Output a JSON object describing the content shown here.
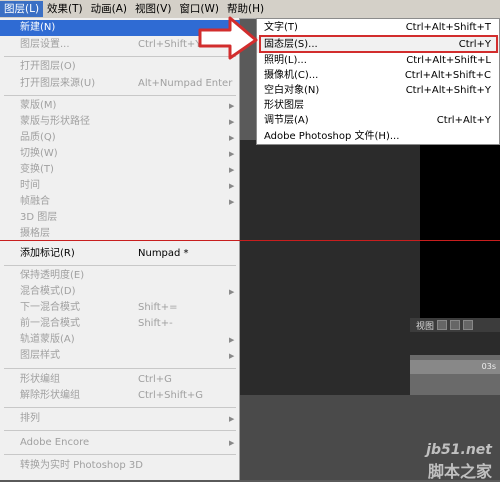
{
  "menubar": {
    "items": [
      "图层(L)",
      "效果(T)",
      "动画(A)",
      "视图(V)",
      "窗口(W)",
      "帮助(H)"
    ]
  },
  "layer_menu": {
    "items": [
      {
        "label": "新建(N)",
        "shortcut": "",
        "submenu": true
      },
      {
        "label": "图层设置...",
        "shortcut": "Ctrl+Shift+Y"
      },
      {
        "label": "打开图层(O)",
        "shortcut": ""
      },
      {
        "label": "打开图层来源(U)",
        "shortcut": "Alt+Numpad Enter"
      },
      {
        "label": "蒙版(M)",
        "shortcut": "",
        "submenu": true
      },
      {
        "label": "蒙版与形状路径",
        "shortcut": "",
        "submenu": true
      },
      {
        "label": "品质(Q)",
        "shortcut": "",
        "submenu": true
      },
      {
        "label": "切换(W)",
        "shortcut": "",
        "submenu": true
      },
      {
        "label": "变换(T)",
        "shortcut": "",
        "submenu": true
      },
      {
        "label": "时间",
        "shortcut": "",
        "submenu": true
      },
      {
        "label": "帧融合",
        "shortcut": "",
        "submenu": true
      },
      {
        "label": "3D 图层",
        "shortcut": ""
      },
      {
        "label": "摄格层",
        "shortcut": ""
      },
      {
        "label": "添加标记(R)",
        "shortcut": "Numpad *"
      },
      {
        "label": "保持透明度(E)",
        "shortcut": ""
      },
      {
        "label": "混合模式(D)",
        "shortcut": "",
        "submenu": true
      },
      {
        "label": "下一混合模式",
        "shortcut": "Shift+="
      },
      {
        "label": "前一混合模式",
        "shortcut": "Shift+-"
      },
      {
        "label": "轨道蒙版(A)",
        "shortcut": "",
        "submenu": true
      },
      {
        "label": "图层样式",
        "shortcut": "",
        "submenu": true
      },
      {
        "label": "形状编组",
        "shortcut": "Ctrl+G"
      },
      {
        "label": "解除形状编组",
        "shortcut": "Ctrl+Shift+G"
      },
      {
        "label": "排列",
        "shortcut": "",
        "submenu": true
      },
      {
        "label": "Adobe Encore",
        "shortcut": "",
        "submenu": true
      },
      {
        "label": "转换为实时 Photoshop 3D",
        "shortcut": ""
      }
    ]
  },
  "new_submenu": {
    "items": [
      {
        "label": "文字(T)",
        "shortcut": "Ctrl+Alt+Shift+T"
      },
      {
        "label": "固态层(S)...",
        "shortcut": "Ctrl+Y"
      },
      {
        "label": "照明(L)...",
        "shortcut": "Ctrl+Alt+Shift+L"
      },
      {
        "label": "摄像机(C)...",
        "shortcut": "Ctrl+Alt+Shift+C"
      },
      {
        "label": "空白对象(N)",
        "shortcut": "Ctrl+Alt+Shift+Y"
      },
      {
        "label": "形状图层",
        "shortcut": ""
      },
      {
        "label": "调节层(A)",
        "shortcut": "Ctrl+Alt+Y"
      },
      {
        "label": "Adobe Photoshop 文件(H)...",
        "shortcut": ""
      }
    ]
  },
  "background": {
    "view_label": "视图",
    "ruler_label": "03s"
  },
  "watermark": {
    "site": "jb51.net",
    "name": "脚本之家"
  },
  "colors": {
    "highlight": "#2f6bd3",
    "annotation_red": "#d22d2d"
  }
}
